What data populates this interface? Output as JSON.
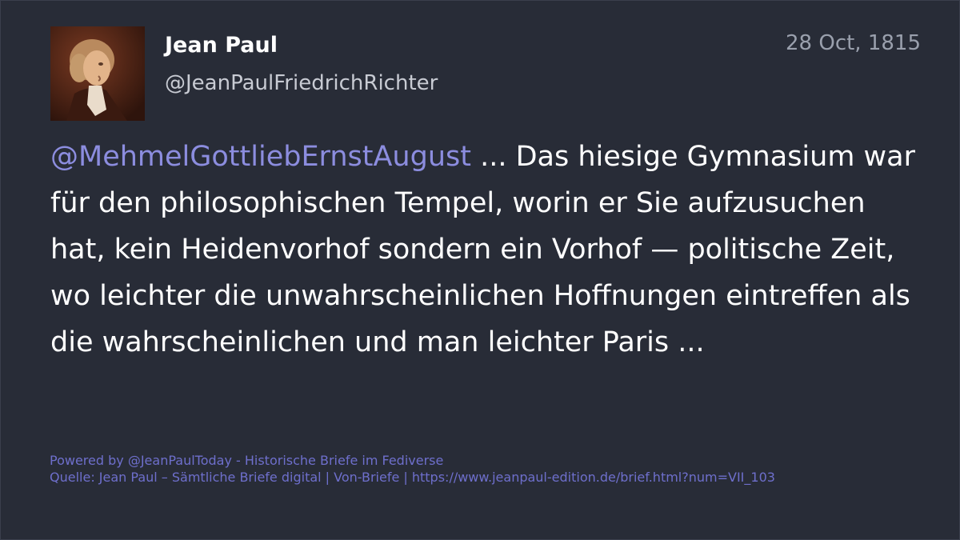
{
  "colors": {
    "background": "#282c37",
    "mention": "#8c8ddf",
    "footer": "#6e6fcc",
    "date": "#9aa0ad"
  },
  "account": {
    "display_name": "Jean Paul",
    "handle": "@JeanPaulFriedrichRichter",
    "avatar_icon": "portrait-avatar"
  },
  "status": {
    "date": "28 Oct, 1815",
    "mention": "@MehmelGottliebErnstAugust",
    "text": " ... Das hiesige Gymnasium war für den philosophischen Tempel, worin er Sie aufzusuchen hat, kein Heidenvorhof sondern ein Vorhof — politische Zeit, wo leichter die unwahrscheinlichen Hoffnungen eintreffen als die wahrscheinlichen und man leichter Paris ..."
  },
  "footer": {
    "powered_by": "Powered by @JeanPaulToday - Historische Briefe im Fediverse",
    "source": "Quelle: Jean Paul – Sämtliche Briefe digital | Von-Briefe | https://www.jeanpaul-edition.de/brief.html?num=VII_103"
  }
}
